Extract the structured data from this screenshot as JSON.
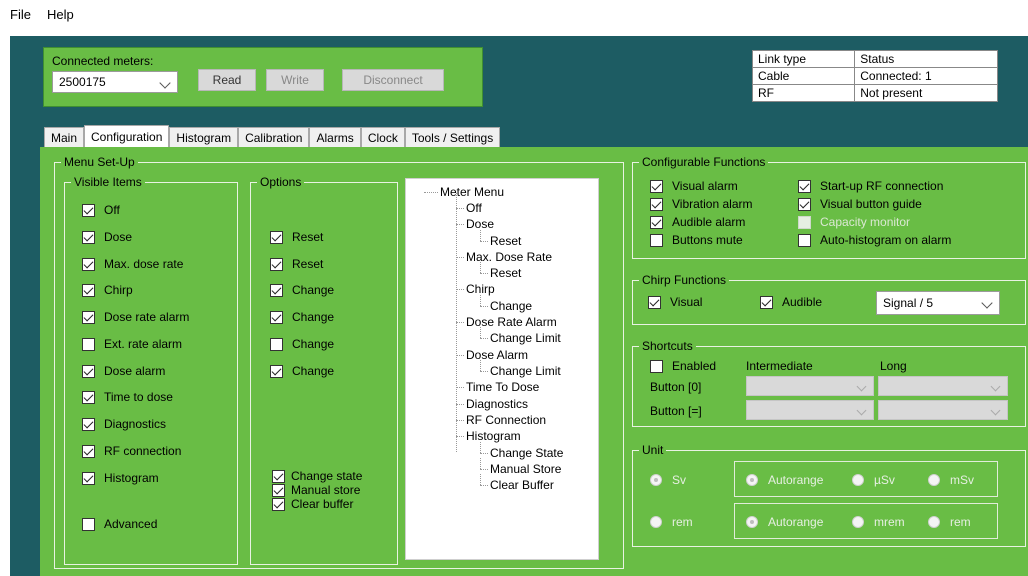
{
  "menubar": {
    "file": "File",
    "help": "Help"
  },
  "connection": {
    "label": "Connected meters:",
    "meter": "2500175",
    "read": "Read",
    "write": "Write",
    "disconnect": "Disconnect"
  },
  "link_table": {
    "headers": [
      "Link type",
      "Status"
    ],
    "rows": [
      [
        "Cable",
        "Connected: 1"
      ],
      [
        "RF",
        "Not present"
      ]
    ]
  },
  "tabs": [
    "Main",
    "Configuration",
    "Histogram",
    "Calibration",
    "Alarms",
    "Clock",
    "Tools / Settings"
  ],
  "menu_setup": {
    "title": "Menu Set-Up",
    "visible_title": "Visible Items",
    "options_title": "Options",
    "visible_items": [
      {
        "label": "Off",
        "checked": true
      },
      {
        "label": "Dose",
        "checked": true
      },
      {
        "label": "Max. dose rate",
        "checked": true
      },
      {
        "label": "Chirp",
        "checked": true
      },
      {
        "label": "Dose rate alarm",
        "checked": true
      },
      {
        "label": "Ext. rate alarm",
        "checked": false
      },
      {
        "label": "Dose alarm",
        "checked": true
      },
      {
        "label": "Time to dose",
        "checked": true
      },
      {
        "label": "Diagnostics",
        "checked": true
      },
      {
        "label": "RF connection",
        "checked": true
      },
      {
        "label": "Histogram",
        "checked": true
      },
      {
        "label": "Advanced",
        "checked": false
      }
    ],
    "options": [
      {
        "label": "Reset",
        "checked": true
      },
      {
        "label": "Reset",
        "checked": true
      },
      {
        "label": "Change",
        "checked": true
      },
      {
        "label": "Change",
        "checked": true
      },
      {
        "label": "Change",
        "checked": false
      },
      {
        "label": "Change",
        "checked": true
      }
    ],
    "hist_options": [
      {
        "label": "Change state",
        "checked": true
      },
      {
        "label": "Manual store",
        "checked": true
      },
      {
        "label": "Clear buffer",
        "checked": true
      }
    ]
  },
  "tree": {
    "root": "Meter Menu",
    "items": [
      "Off",
      "Dose",
      "Reset",
      "Max. Dose Rate",
      "Reset",
      "Chirp",
      "Change",
      "Dose Rate Alarm",
      "Change Limit",
      "Dose Alarm",
      "Change Limit",
      "Time To Dose",
      "Diagnostics",
      "RF Connection",
      "Histogram",
      "Change State",
      "Manual Store",
      "Clear Buffer"
    ]
  },
  "configurable": {
    "title": "Configurable Functions",
    "items": [
      {
        "label": "Visual alarm",
        "checked": true,
        "enabled": true
      },
      {
        "label": "Start-up RF connection",
        "checked": true,
        "enabled": true
      },
      {
        "label": "Vibration alarm",
        "checked": true,
        "enabled": true
      },
      {
        "label": "Visual button guide",
        "checked": true,
        "enabled": true
      },
      {
        "label": "Audible alarm",
        "checked": true,
        "enabled": true
      },
      {
        "label": "Capacity monitor",
        "checked": false,
        "enabled": false
      },
      {
        "label": "Buttons mute",
        "checked": false,
        "enabled": true
      },
      {
        "label": "Auto-histogram on alarm",
        "checked": false,
        "enabled": true
      }
    ]
  },
  "chirp": {
    "title": "Chirp Functions",
    "visual": "Visual",
    "audible": "Audible",
    "signal": "Signal / 5"
  },
  "shortcuts": {
    "title": "Shortcuts",
    "enabled": "Enabled",
    "intermediate": "Intermediate",
    "long": "Long",
    "button0": "Button [0]",
    "button1": "Button [=]"
  },
  "unit": {
    "title": "Unit",
    "sv": "Sv",
    "rem": "rem",
    "autorange1": "Autorange",
    "usv": "µSv",
    "msv": "mSv",
    "autorange2": "Autorange",
    "mrem": "mrem",
    "rem2": "rem"
  }
}
